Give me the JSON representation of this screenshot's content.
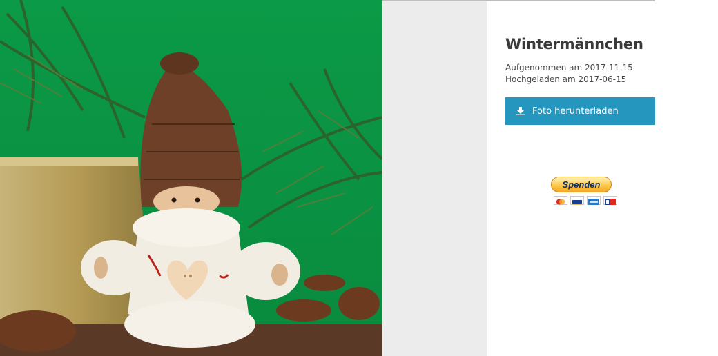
{
  "photo": {
    "title": "Wintermännchen",
    "taken_label": "Aufgenommen am 2017-11-15",
    "uploaded_label": "Hochgeladen am 2017-06-15"
  },
  "actions": {
    "download_label": "Foto herunterladen",
    "download_icon": "download-icon",
    "donate_label": "Spenden"
  },
  "payment_icons": [
    "mastercard-icon",
    "visa-icon",
    "amex-icon",
    "ec-icon"
  ],
  "colors": {
    "accent": "#2596be",
    "title_text": "#3a3a3a",
    "side_strip": "#ececec",
    "donate_button": "#fdc94a"
  }
}
